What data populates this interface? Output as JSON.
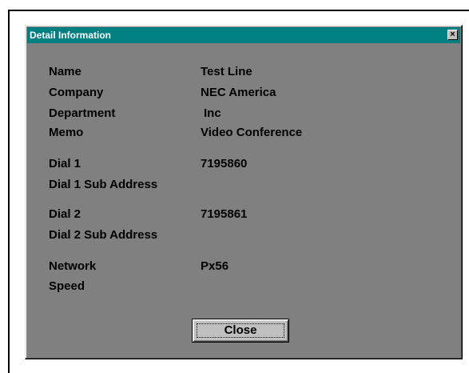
{
  "window": {
    "title": "Detail Information",
    "close_glyph": "×"
  },
  "fields": {
    "name": {
      "label": "Name",
      "value": "Test Line"
    },
    "company": {
      "label": "Company",
      "value": "NEC America"
    },
    "department": {
      "label": "Department",
      "value": "Inc"
    },
    "memo": {
      "label": "Memo",
      "value": "Video Conference"
    },
    "dial1": {
      "label": "Dial 1",
      "value": "7195860"
    },
    "dial1_sub": {
      "label": "Dial 1 Sub Address",
      "value": ""
    },
    "dial2": {
      "label": "Dial 2",
      "value": "7195861"
    },
    "dial2_sub": {
      "label": "Dial 2 Sub Address",
      "value": ""
    },
    "network": {
      "label": "Network",
      "value": "Px56"
    },
    "speed": {
      "label": "Speed",
      "value": ""
    }
  },
  "buttons": {
    "close_label": "Close"
  },
  "colors": {
    "titlebar": "#008080",
    "dialog_background": "#808080",
    "button_face": "#c0c0c0"
  },
  "icons": {
    "title_close": "close-icon"
  }
}
